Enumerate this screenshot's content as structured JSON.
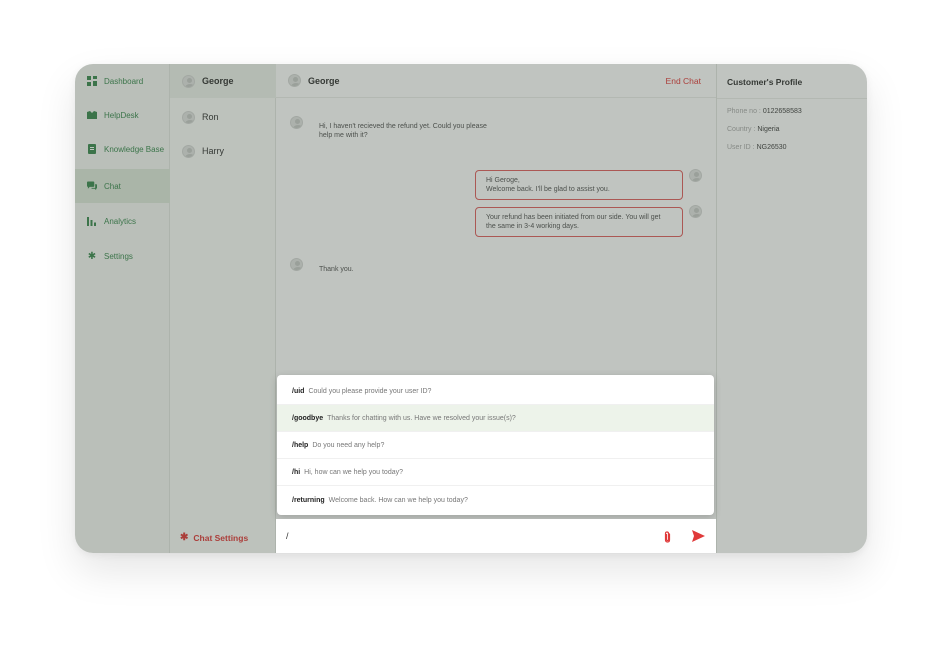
{
  "nav": {
    "items": [
      {
        "label": "Dashboard",
        "icon": "dashboard-icon"
      },
      {
        "label": "HelpDesk",
        "icon": "helpdesk-icon"
      },
      {
        "label": "Knowledge Base",
        "icon": "book-icon"
      },
      {
        "label": "Chat",
        "icon": "chat-icon",
        "active": true
      },
      {
        "label": "Analytics",
        "icon": "bar-chart-icon"
      },
      {
        "label": "Settings",
        "icon": "gear-icon"
      }
    ]
  },
  "contacts": {
    "items": [
      {
        "name": "George",
        "active": true
      },
      {
        "name": "Ron"
      },
      {
        "name": "Harry"
      }
    ],
    "settings_label": "Chat Settings"
  },
  "chat": {
    "header_name": "George",
    "end_chat_label": "End Chat",
    "messages": [
      {
        "side": "in",
        "text": "Hi, I haven't recieved the refund yet. Could you please help me with it?"
      },
      {
        "side": "out",
        "line1": "Hi Geroge,",
        "line2": "Welcome back. I'll be glad to assist you."
      },
      {
        "side": "out",
        "text": "Your refund has been initiated from our side. You will get the same in 3-4 working days."
      },
      {
        "side": "in",
        "text": "Thank you."
      }
    ],
    "suggestions": [
      {
        "cmd": "/uid",
        "text": "Could you please provide your user ID?"
      },
      {
        "cmd": "/goodbye",
        "text": "Thanks for chatting with us. Have we resolved your issue(s)?",
        "active": true
      },
      {
        "cmd": "/help",
        "text": "Do you need any help?"
      },
      {
        "cmd": "/hi",
        "text": "Hi, how can we help you today?"
      },
      {
        "cmd": "/returning",
        "text": "Welcome back. How can we help you today?"
      }
    ],
    "input_value": "/"
  },
  "profile": {
    "title": "Customer's Profile",
    "phone_label": "Phone no :",
    "phone_value": "0122658583",
    "country_label": "Country :",
    "country_value": "Nigeria",
    "userid_label": "User ID :",
    "userid_value": "NG26530"
  },
  "colors": {
    "accent_green": "#3d8a52",
    "accent_red": "#e03a3a"
  }
}
